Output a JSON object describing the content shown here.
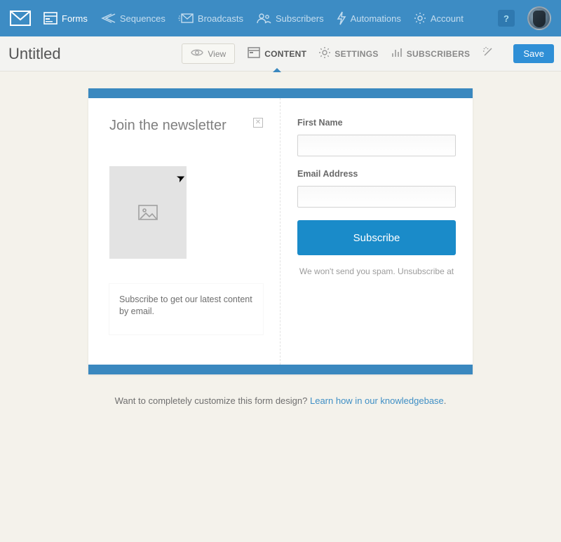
{
  "nav": {
    "items": [
      {
        "label": "Forms",
        "active": true
      },
      {
        "label": "Sequences"
      },
      {
        "label": "Broadcasts"
      },
      {
        "label": "Subscribers"
      },
      {
        "label": "Automations"
      },
      {
        "label": "Account"
      }
    ],
    "help": "?"
  },
  "subheader": {
    "title": "Untitled",
    "view_label": "View",
    "tabs": {
      "content": "CONTENT",
      "settings": "SETTINGS",
      "subscribers": "SUBSCRIBERS"
    },
    "save_label": "Save"
  },
  "form": {
    "headline": "Join the newsletter",
    "description": "Subscribe to get our latest content by email.",
    "first_name_label": "First Name",
    "first_name_value": "",
    "email_label": "Email Address",
    "email_value": "",
    "subscribe_label": "Subscribe",
    "spam_note": "We won't send you spam. Unsubscribe at"
  },
  "footer": {
    "text": "Want to completely customize this form design? ",
    "link": "Learn how in our knowledgebase",
    "dot": "."
  }
}
